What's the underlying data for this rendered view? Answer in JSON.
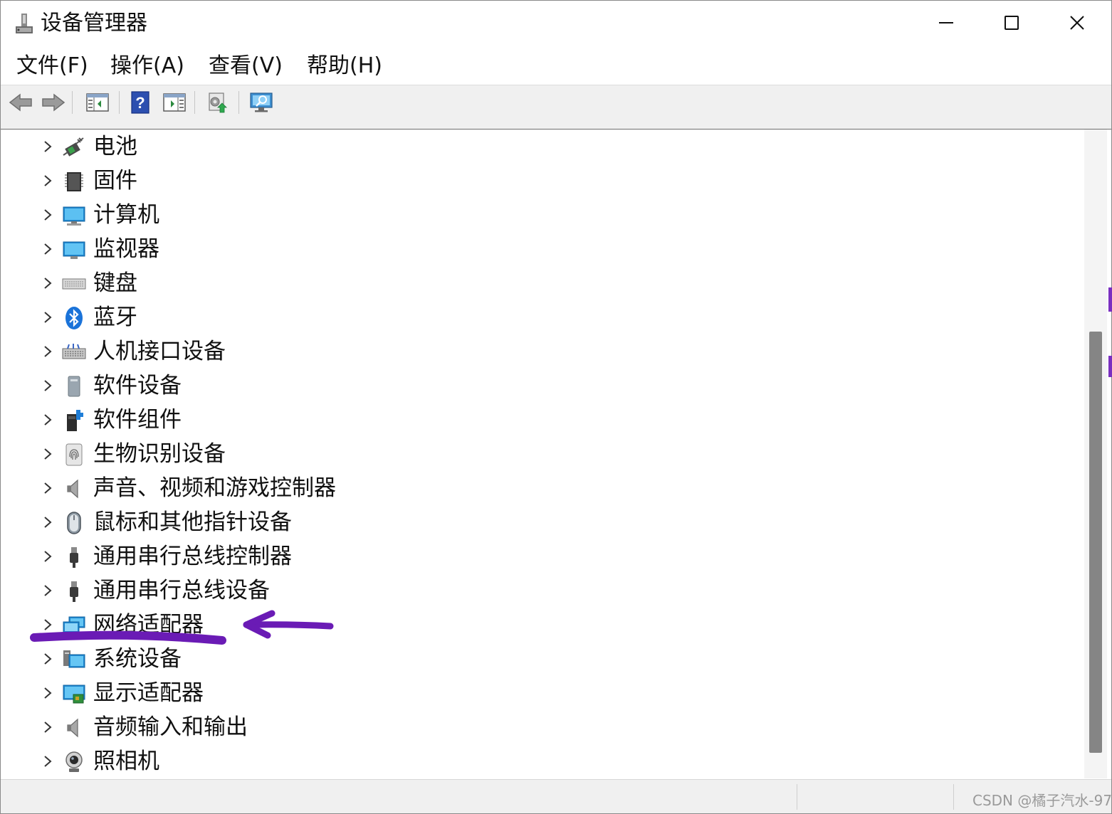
{
  "window": {
    "title": "设备管理器",
    "icons": {
      "app": "device-manager-icon",
      "minimize": "minimize-icon",
      "maximize": "maximize-icon",
      "close": "close-icon"
    }
  },
  "menu": [
    "文件(F)",
    "操作(A)",
    "查看(V)",
    "帮助(H)"
  ],
  "toolbar": [
    "back-arrow-icon",
    "forward-arrow-icon",
    "show-hide-console-tree-icon",
    "help-icon",
    "show-action-pane-icon",
    "update-driver-icon",
    "scan-hardware-changes-icon"
  ],
  "tree": {
    "items": [
      {
        "label": "电池",
        "icon": "battery-icon"
      },
      {
        "label": "固件",
        "icon": "firmware-chip-icon"
      },
      {
        "label": "计算机",
        "icon": "computer-icon"
      },
      {
        "label": "监视器",
        "icon": "monitor-icon"
      },
      {
        "label": "键盘",
        "icon": "keyboard-icon"
      },
      {
        "label": "蓝牙",
        "icon": "bluetooth-icon"
      },
      {
        "label": "人机接口设备",
        "icon": "hid-icon"
      },
      {
        "label": "软件设备",
        "icon": "software-device-icon"
      },
      {
        "label": "软件组件",
        "icon": "software-component-icon"
      },
      {
        "label": "生物识别设备",
        "icon": "fingerprint-icon"
      },
      {
        "label": "声音、视频和游戏控制器",
        "icon": "speaker-icon"
      },
      {
        "label": "鼠标和其他指针设备",
        "icon": "mouse-icon"
      },
      {
        "label": "通用串行总线控制器",
        "icon": "usb-icon"
      },
      {
        "label": "通用串行总线设备",
        "icon": "usb-icon"
      },
      {
        "label": "网络适配器",
        "icon": "network-adapter-icon"
      },
      {
        "label": "系统设备",
        "icon": "system-device-icon"
      },
      {
        "label": "显示适配器",
        "icon": "display-adapter-icon"
      },
      {
        "label": "音频输入和输出",
        "icon": "speaker-icon"
      },
      {
        "label": "照相机",
        "icon": "camera-icon"
      }
    ]
  },
  "annotation": {
    "color": "#6a1bb5",
    "target": "网络适配器"
  },
  "watermark": "CSDN @橘子汽水-97"
}
